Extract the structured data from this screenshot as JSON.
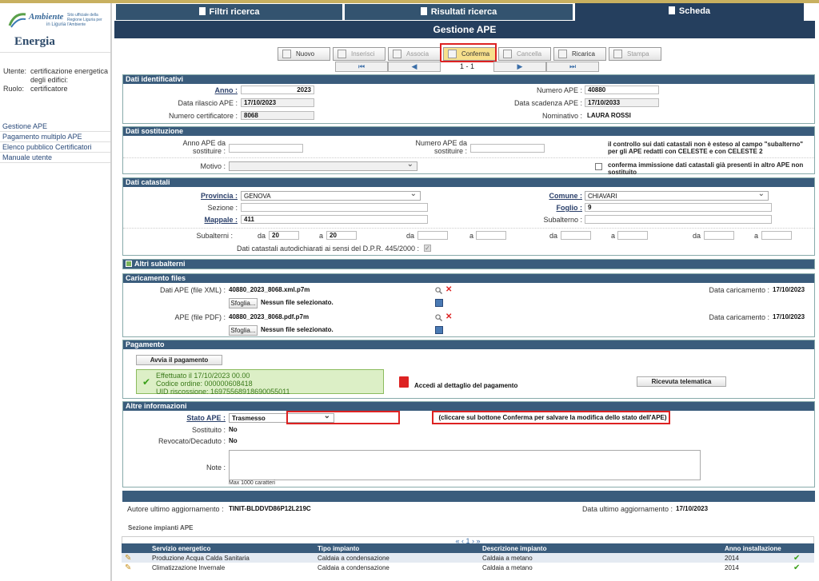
{
  "sidebar": {
    "logo": {
      "brand": "Ambiente",
      "region": "in Liguria",
      "tagline": "Sito ufficiale della Regione Liguria per l'Ambiente"
    },
    "section": "Energia",
    "utente_label": "Utente:",
    "utente_value": "certificazione energetica degli edifici:",
    "ruolo_label": "Ruolo:",
    "ruolo_value": "certificatore",
    "menu": [
      "Gestione APE",
      "Pagamento multiplo APE",
      "Elenco pubblico Certificatori",
      "Manuale utente"
    ]
  },
  "tabs": [
    "Filtri ricerca",
    "Risultati ricerca",
    "Scheda"
  ],
  "page_title": "Gestione APE",
  "toolbar": {
    "nuovo": "Nuovo",
    "inserisci": "Inserisci",
    "associa": "Associa",
    "conferma": "Conferma",
    "cancella": "Cancella",
    "ricarica": "Ricarica",
    "stampa": "Stampa"
  },
  "pager": {
    "first": "⏮",
    "prev": "◀",
    "count": "1 - 1",
    "next": "▶",
    "last": "⏭"
  },
  "dati_identificativi": {
    "header": "Dati identificativi",
    "anno_label": "Anno :",
    "anno": "2023",
    "numero_ape_label": "Numero APE :",
    "numero_ape": "40880",
    "data_rilascio_label": "Data rilascio APE :",
    "data_rilascio": "17/10/2023",
    "data_scadenza_label": "Data scadenza APE :",
    "data_scadenza": "17/10/2033",
    "numero_cert_label": "Numero certificatore :",
    "numero_cert": "8068",
    "nominativo_label": "Nominativo :",
    "nominativo": "LAURA ROSSI"
  },
  "dati_sostituzione": {
    "header": "Dati sostituzione",
    "anno_label": "Anno APE da sostituire :",
    "numero_label": "Numero APE da sostituire :",
    "note_controllo": "il controllo sui dati catastali non è esteso al campo \"subalterno\" per gli APE redatti con CELESTE e con CELESTE 2",
    "motivo_label": "Motivo :",
    "conferma_label": "conferma immissione dati catastali già presenti in altro APE non sostituito"
  },
  "dati_catastali": {
    "header": "Dati catastali",
    "provincia_label": "Provincia :",
    "provincia": "GENOVA",
    "comune_label": "Comune :",
    "comune": "CHIAVARI",
    "sezione_label": "Sezione :",
    "foglio_label": "Foglio :",
    "foglio": "9",
    "mappale_label": "Mappale :",
    "mappale": "411",
    "subalterno_label": "Subalterno :",
    "subalterni_label": "Subalterni :",
    "da": "da",
    "a": "a",
    "sub_da": "20",
    "sub_a": "20",
    "autodich_label": "Dati catastali autodichiarati ai sensi del D.P.R. 445/2000 :"
  },
  "altri_subalterni": "Altri subalterni",
  "caricamento": {
    "header": "Caricamento files",
    "xml_label": "Dati APE (file XML) :",
    "xml_file": "40880_2023_8068.xml.p7m",
    "pdf_label": "APE (file PDF) :",
    "pdf_file": "40880_2023_8068.pdf.p7m",
    "sfoglia": "Sfoglia...",
    "nessun": "Nessun file selezionato.",
    "data_car_label": "Data caricamento :",
    "data_car": "17/10/2023"
  },
  "pagamento": {
    "header": "Pagamento",
    "avvia": "Avvia il pagamento",
    "line1": "Effettuato il 17/10/2023 00.00",
    "line2": "Codice ordine: 000000608418",
    "line3": "UID riscossione: 16975568918690055011",
    "dettaglio": "Accedi al dettaglio del pagamento",
    "ricevuta": "Ricevuta telematica"
  },
  "altre": {
    "header": "Altre informazioni",
    "stato_label": "Stato APE :",
    "stato": "Trasmesso",
    "hint": "(cliccare sul bottone Conferma per salvare la modifica dello stato dell'APE)",
    "sostituito_label": "Sostituito :",
    "sostituito": "No",
    "revocato_label": "Revocato/Decaduto :",
    "revocato": "No",
    "note_label": "Note :",
    "max": "Max 1000 caratteri"
  },
  "footer": {
    "autore_label": "Autore ultimo aggiornamento :",
    "autore": "TINIT-BLDDVD86P12L219C",
    "data_label": "Data ultimo aggiornamento :",
    "data": "17/10/2023"
  },
  "impianti": {
    "title": "Sezione impianti APE",
    "pager": "« ‹ 1 › »",
    "columns": [
      "Servizio energetico",
      "Tipo impianto",
      "Descrizione impianto",
      "Anno installazione"
    ],
    "rows": [
      {
        "servizio": "Produzione Acqua Calda Sanitaria",
        "tipo": "Caldaia a condensazione",
        "descrizione": "Caldaia a metano",
        "anno": "2014"
      },
      {
        "servizio": "Climatizzazione Invernale",
        "tipo": "Caldaia a condensazione",
        "descrizione": "Caldaia a metano",
        "anno": "2014"
      }
    ]
  },
  "colors": {
    "header_blue": "#253f5e",
    "section_blue": "#3a5c7c",
    "highlight_red": "#dd2222",
    "confirm_yellow": "#f7e08c"
  }
}
